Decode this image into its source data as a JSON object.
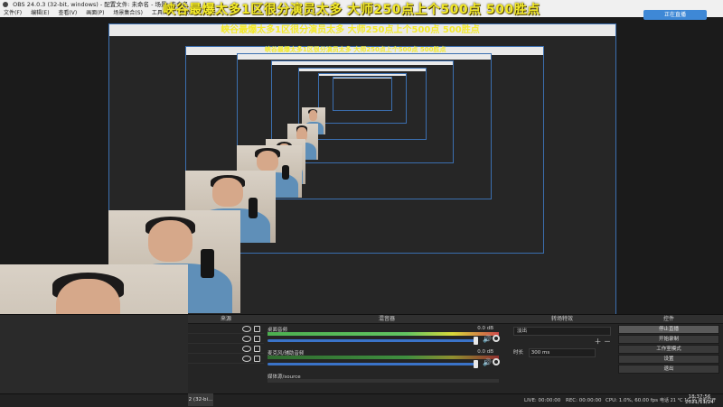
{
  "window": {
    "title": "OBS 24.0.3 (32-bit, windows) - 配置文件: 未命名 - 场景: 未命名"
  },
  "menu": [
    "文件(F)",
    "编辑(E)",
    "查看(V)",
    "画面(P)",
    "场景集合(S)",
    "工具(T)",
    "帮助(H)"
  ],
  "overlay": {
    "text": "峡谷最爆太多1区很分演员太多 大师250点上个500点    500胜点"
  },
  "live_badge": "正在直播",
  "docks": {
    "sources": {
      "header": "来源",
      "items": [
        "",
        "",
        "",
        ""
      ]
    },
    "mixer": {
      "header": "混音器",
      "channels": [
        {
          "name": "桌面音频",
          "db": "0.0 dB",
          "level": 0.82
        },
        {
          "name": "麦克风/辅助音频",
          "db": "0.0 dB",
          "level": 0.78
        },
        {
          "name": "媒体源/source",
          "db": "0.0 dB",
          "level": 0.0
        }
      ]
    },
    "transitions": {
      "header": "转场特效",
      "selected": "淡出",
      "duration_label": "时长",
      "duration_value": "300 ms"
    },
    "controls": {
      "header": "控件",
      "buttons": [
        "停止直播",
        "开始录制",
        "工作室模式",
        "设置",
        "退出"
      ]
    }
  },
  "status": {
    "live": "LIVE: 00:00:00",
    "rec": "REC: 00:00:00",
    "cpu": "CPU: 1.0%, 60.00 fps",
    "right": "电话 21 °C 1G 区 双击打开"
  },
  "clock": {
    "time": "18:37:56",
    "date": "2021/11/24"
  },
  "taskbar_app": "2 (32-bi..."
}
